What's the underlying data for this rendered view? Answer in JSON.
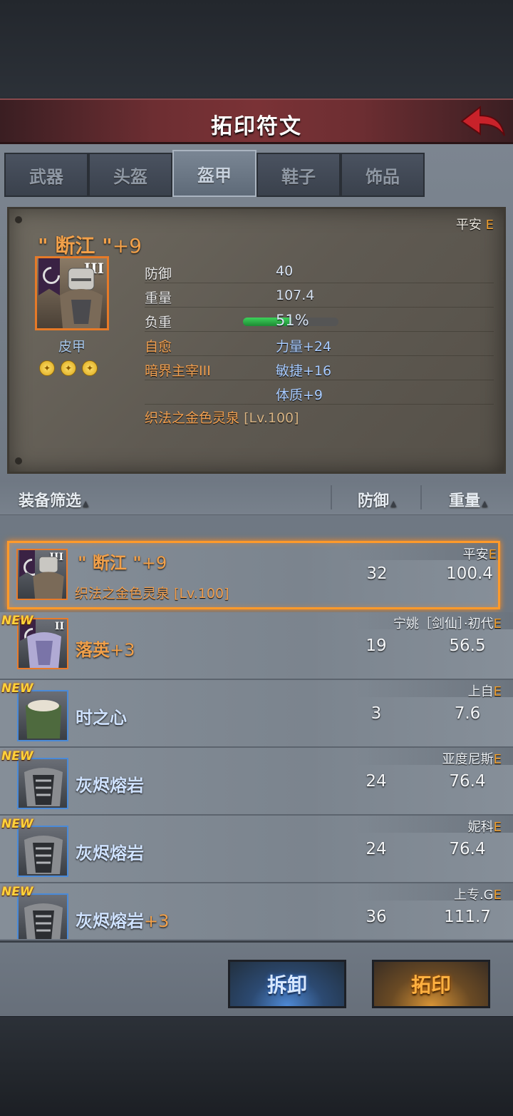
{
  "header": {
    "title": "拓印符文"
  },
  "tabs": [
    {
      "label": "武器",
      "active": false
    },
    {
      "label": "头盔",
      "active": false
    },
    {
      "label": "盔甲",
      "active": true
    },
    {
      "label": "鞋子",
      "active": false
    },
    {
      "label": "饰品",
      "active": false
    }
  ],
  "detail": {
    "owner": "平安",
    "grade": "E",
    "name": "\" 断江 \"",
    "plus": "+9",
    "tier": "III",
    "type": "皮甲",
    "stars": 3,
    "stats": {
      "defense_label": "防御",
      "defense_value": "40",
      "weight_label": "重量",
      "weight_value": "107.4",
      "load_label": "负重",
      "load_value": "51%",
      "load_fraction": 0.51,
      "skill1": "自愈",
      "bonus1": "力量+24",
      "skill2": "暗界主宰III",
      "bonus2": "敏捷+16",
      "bonus3": "体质+9"
    },
    "set_name": "织法之金色灵泉",
    "set_level": "[Lv.100]"
  },
  "list_header": {
    "filter": "装备筛选",
    "defense": "防御",
    "weight": "重量"
  },
  "items": [
    {
      "owner": "平安",
      "grade": "E",
      "name": "\" 断江 \"",
      "plus": "+9",
      "sub": "织法之金色灵泉 [Lv.100]",
      "tier": "III",
      "defense": "32",
      "weight": "100.4",
      "new": false,
      "selected": true
    },
    {
      "owner": "宁姚［剑仙］·初代",
      "grade": "E",
      "name": "落英",
      "plus": "+3",
      "tier": "II",
      "defense": "19",
      "weight": "56.5",
      "new": true,
      "new_label": "NEW"
    },
    {
      "owner": "上自",
      "grade": "E",
      "name": "时之心",
      "plus": "",
      "defense": "3",
      "weight": "7.6",
      "new": true,
      "new_label": "NEW"
    },
    {
      "owner": "亚度尼斯",
      "grade": "E",
      "name": "灰烬熔岩",
      "plus": "",
      "defense": "24",
      "weight": "76.4",
      "new": true,
      "new_label": "NEW"
    },
    {
      "owner": "妮科",
      "grade": "E",
      "name": "灰烬熔岩",
      "plus": "",
      "defense": "24",
      "weight": "76.4",
      "new": true,
      "new_label": "NEW"
    },
    {
      "owner": "上专.G",
      "grade": "E",
      "name": "灰烬熔岩",
      "plus": "+3",
      "defense": "36",
      "weight": "111.7",
      "new": true,
      "new_label": "NEW"
    }
  ],
  "buttons": {
    "dismantle": "拆卸",
    "imprint": "拓印"
  },
  "icons": [
    "back-arrow-icon",
    "rune-star-icon",
    "sort-triangle-icon",
    "banner-icon"
  ]
}
